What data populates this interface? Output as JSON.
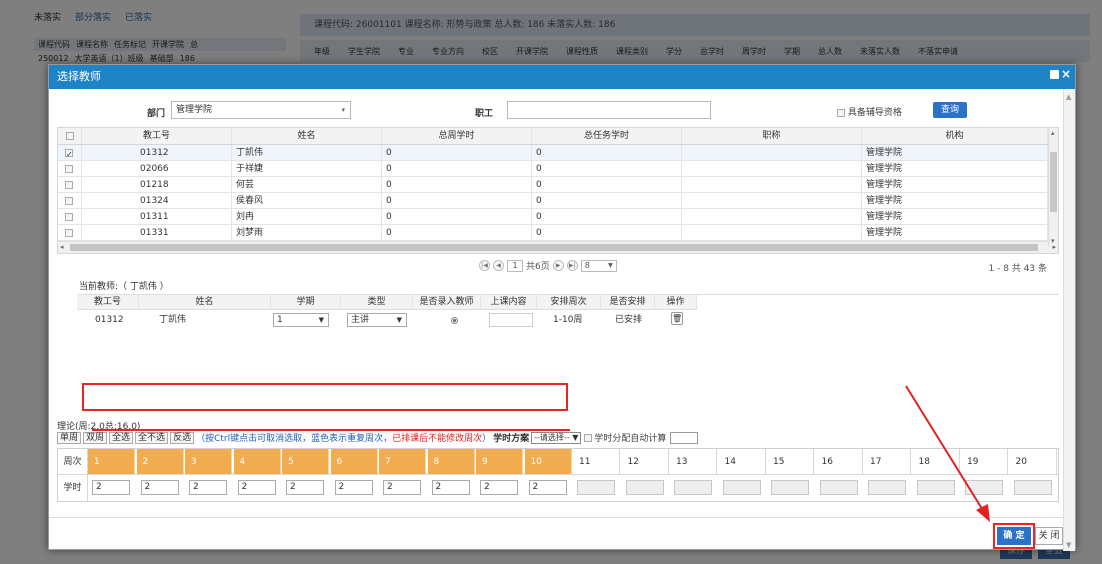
{
  "background": {
    "tabs": [
      "未落实",
      "部分落实",
      "已落实"
    ],
    "left_header": [
      "课程代码",
      "课程名称",
      "任务标记",
      "开课学院",
      "总"
    ],
    "left_row": [
      "250012",
      "大学英语（1）班级",
      "基础部",
      "186"
    ],
    "course_info": "课程代码: 26001101  课程名称: 形势与政策  总人数: 186  未落实人数: 186",
    "columns": [
      "年级",
      "学生学院",
      "专业",
      "专业方向",
      "校区",
      "开课学院",
      "课程性质",
      "课程类别",
      "学分",
      "总学时",
      "周学时",
      "学期",
      "总人数",
      "未落实人数",
      "不落实申请"
    ],
    "buttons": [
      "保存",
      "重置"
    ]
  },
  "modal": {
    "title": "选择教师",
    "filter": {
      "dept_label": "部门",
      "dept_value": "管理学院",
      "staff_label": "职工",
      "staff_value": "",
      "tutor_label": "具备辅导资格",
      "query_button": "查询"
    },
    "grid": {
      "headers": [
        "教工号",
        "姓名",
        "总周学时",
        "总任务学时",
        "职称",
        "机构"
      ],
      "rows": [
        {
          "id": "01312",
          "name": "丁凯伟",
          "week_hours": "0",
          "task_hours": "0",
          "title": "",
          "org": "管理学院",
          "checked": true
        },
        {
          "id": "02066",
          "name": "于祥婕",
          "week_hours": "0",
          "task_hours": "0",
          "title": "",
          "org": "管理学院",
          "checked": false
        },
        {
          "id": "01218",
          "name": "何芸",
          "week_hours": "0",
          "task_hours": "0",
          "title": "",
          "org": "管理学院",
          "checked": false
        },
        {
          "id": "01324",
          "name": "侯春风",
          "week_hours": "0",
          "task_hours": "0",
          "title": "",
          "org": "管理学院",
          "checked": false
        },
        {
          "id": "01311",
          "name": "刘冉",
          "week_hours": "0",
          "task_hours": "0",
          "title": "",
          "org": "管理学院",
          "checked": false
        },
        {
          "id": "01331",
          "name": "刘梦雨",
          "week_hours": "0",
          "task_hours": "0",
          "title": "",
          "org": "管理学院",
          "checked": false
        }
      ]
    },
    "pager": {
      "current_page": "1",
      "total_pages": "共6页",
      "page_size": "8",
      "summary": "1 - 8  共 43 条"
    },
    "current": {
      "label": "当前教师:（ 丁凯伟 ）",
      "headers": [
        "教工号",
        "姓名",
        "学期",
        "类型",
        "是否录入教师",
        "上课内容",
        "安排周次",
        "是否安排",
        "操作"
      ],
      "row": {
        "id": "01312",
        "name": "丁凯伟",
        "term": "1",
        "type": "主讲",
        "content": "",
        "weeks": "1-10周",
        "arranged": "已安排"
      }
    },
    "week": {
      "theory": "理论(周:2.0总:16.0)",
      "buttons": [
        "单周",
        "双周",
        "全选",
        "全不选",
        "反选"
      ],
      "hint_open": "（按Ctrl键点击可取消选取，",
      "hint_blue": "蓝色表示重复周次，",
      "hint_red": "已排课后不能修改周次",
      "hint_close": "）",
      "scheme_label": "学时方案",
      "scheme_value": "--请选择--",
      "auto_label": "学时分配自动计算",
      "row_week_label": "周次",
      "row_hours_label": "学时",
      "weeks": [
        "1",
        "2",
        "3",
        "4",
        "5",
        "6",
        "7",
        "8",
        "9",
        "10",
        "11",
        "12",
        "13",
        "14",
        "15",
        "16",
        "17",
        "18",
        "19",
        "20"
      ],
      "hours": [
        "2",
        "2",
        "2",
        "2",
        "2",
        "2",
        "2",
        "2",
        "2",
        "2",
        "",
        "",
        "",
        "",
        "",
        "",
        "",
        "",
        "",
        ""
      ]
    },
    "footer": {
      "ok": "确 定",
      "close": "关 闭"
    }
  },
  "colors": {
    "title_bar": "#1e84c6",
    "selected_week": "#f0ac4e",
    "primary_button": "#2b73c8",
    "annotation_red": "#e22222"
  }
}
